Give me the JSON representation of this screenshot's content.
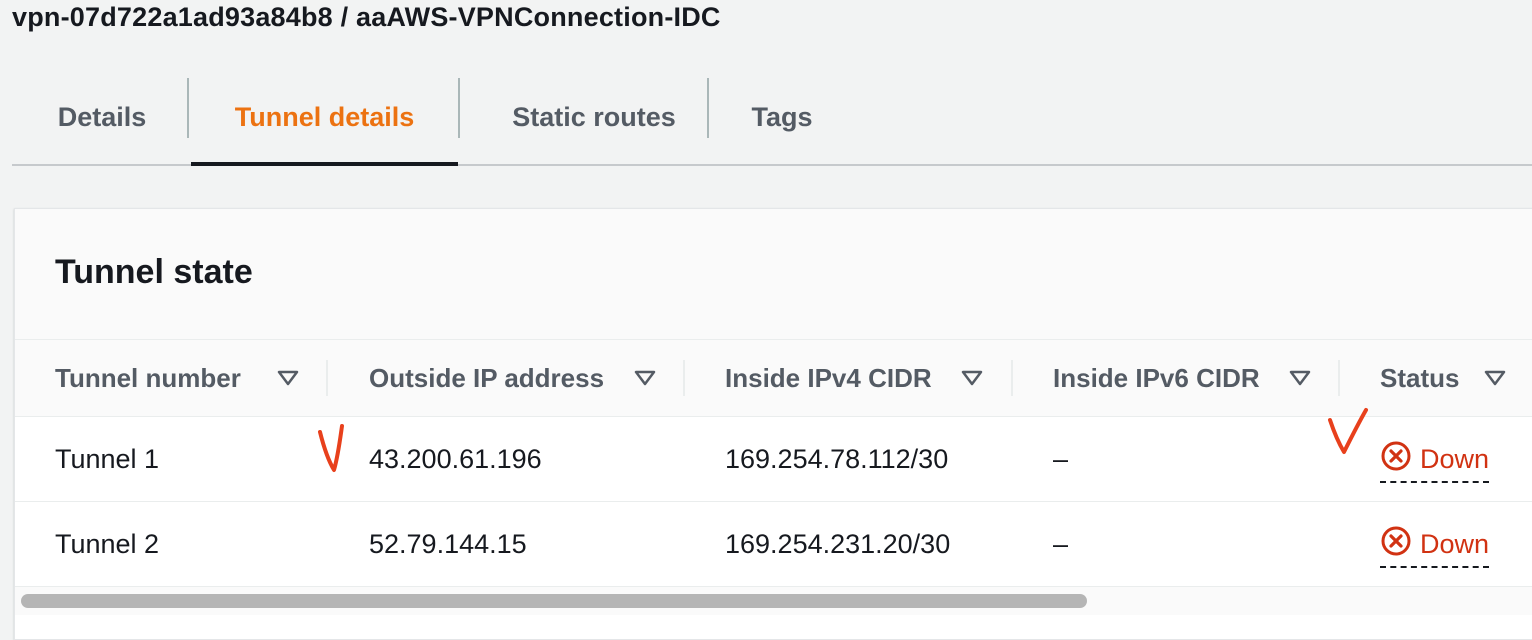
{
  "page": {
    "title": "vpn-07d722a1ad93a84b8 / aaAWS-VPNConnection-IDC"
  },
  "tabs": [
    {
      "label": "Details",
      "active": false
    },
    {
      "label": "Tunnel details",
      "active": true
    },
    {
      "label": "Static routes",
      "active": false
    },
    {
      "label": "Tags",
      "active": false
    }
  ],
  "panel": {
    "title": "Tunnel state"
  },
  "table": {
    "columns": [
      {
        "label": "Tunnel number",
        "icon": "sort-icon"
      },
      {
        "label": "Outside IP address",
        "icon": "sort-icon"
      },
      {
        "label": "Inside IPv4 CIDR",
        "icon": "sort-icon"
      },
      {
        "label": "Inside IPv6 CIDR",
        "icon": "sort-icon"
      },
      {
        "label": "Status",
        "icon": "sort-icon"
      }
    ],
    "rows": [
      {
        "tunnel": "Tunnel 1",
        "outside_ip": "43.200.61.196",
        "inside_ipv4": "169.254.78.112/30",
        "inside_ipv6": "–",
        "status": "Down",
        "status_icon": "error-circle-icon"
      },
      {
        "tunnel": "Tunnel 2",
        "outside_ip": "52.79.144.15",
        "inside_ipv4": "169.254.231.20/30",
        "inside_ipv6": "–",
        "status": "Down",
        "status_icon": "error-circle-icon"
      }
    ]
  },
  "colors": {
    "accent": "#ec7211",
    "status_error": "#d13212",
    "annotation": "#e8401c"
  }
}
